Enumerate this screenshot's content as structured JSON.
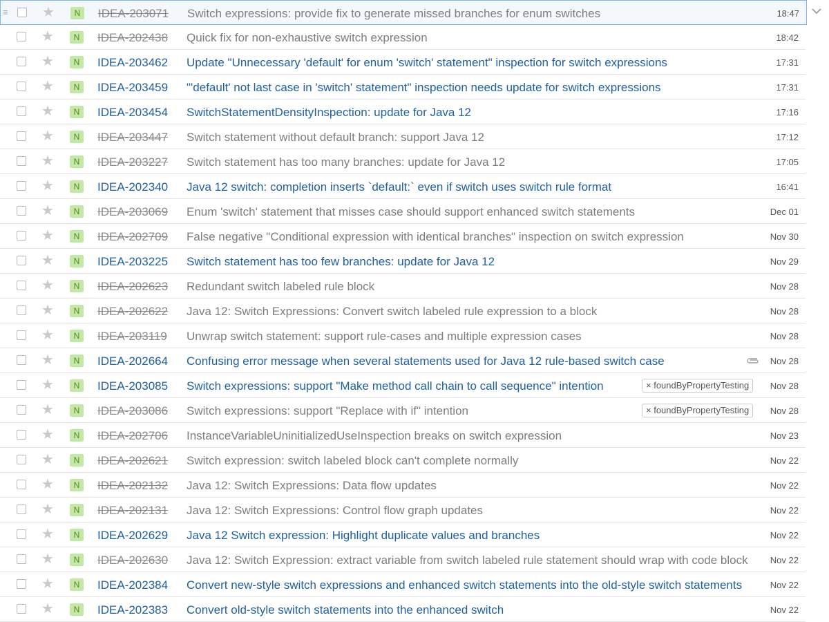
{
  "issues": [
    {
      "id": "IDEA-203071",
      "summary": "Switch expressions: provide fix to generate missed branches for enum switches",
      "date": "18:47",
      "resolved": true,
      "badge": "N"
    },
    {
      "id": "IDEA-202438",
      "summary": "Quick fix for non-exhaustive switch expression",
      "date": "18:42",
      "resolved": true,
      "badge": "N"
    },
    {
      "id": "IDEA-203462",
      "summary": "Update \"Unnecessary 'default' for enum 'switch' statement\" inspection for switch expressions",
      "date": "17:31",
      "resolved": false,
      "badge": "N"
    },
    {
      "id": "IDEA-203459",
      "summary": "\"'default' not last case in 'switch' statement\" inspection needs update for switch expressions",
      "date": "17:31",
      "resolved": false,
      "badge": "N"
    },
    {
      "id": "IDEA-203454",
      "summary": "SwitchStatementDensityInspection: update for Java 12",
      "date": "17:16",
      "resolved": false,
      "badge": "N"
    },
    {
      "id": "IDEA-203447",
      "summary": "Switch statement without default branch: support Java 12",
      "date": "17:12",
      "resolved": true,
      "badge": "N"
    },
    {
      "id": "IDEA-203227",
      "summary": "Switch statement has too many branches: update for Java 12",
      "date": "17:05",
      "resolved": true,
      "badge": "N"
    },
    {
      "id": "IDEA-202340",
      "summary": "Java 12 switch: completion inserts `default:` even if switch uses switch rule format",
      "date": "16:41",
      "resolved": false,
      "badge": "N"
    },
    {
      "id": "IDEA-203069",
      "summary": "Enum 'switch' statement that misses case should support enhanced switch statements",
      "date": "Dec 01",
      "resolved": true,
      "badge": "N"
    },
    {
      "id": "IDEA-202709",
      "summary": "False negative \"Conditional expression with identical branches\" inspection on switch expression",
      "date": "Nov 30",
      "resolved": true,
      "badge": "N"
    },
    {
      "id": "IDEA-203225",
      "summary": "Switch statement has too few branches: update for Java 12",
      "date": "Nov 29",
      "resolved": false,
      "badge": "N"
    },
    {
      "id": "IDEA-202623",
      "summary": "Redundant switch labeled rule block",
      "date": "Nov 28",
      "resolved": true,
      "badge": "N"
    },
    {
      "id": "IDEA-202622",
      "summary": "Java 12: Switch Expressions: Convert switch labeled rule expression to a block",
      "date": "Nov 28",
      "resolved": true,
      "badge": "N"
    },
    {
      "id": "IDEA-203119",
      "summary": "Unwrap switch statement: support rule-cases and multiple expression cases",
      "date": "Nov 28",
      "resolved": true,
      "badge": "N"
    },
    {
      "id": "IDEA-202664",
      "summary": "Confusing error message when several statements used for Java 12 rule-based switch case",
      "date": "Nov 28",
      "resolved": false,
      "badge": "N",
      "attachment": true
    },
    {
      "id": "IDEA-203085",
      "summary": "Switch expressions: support \"Make method call chain to call sequence\" intention",
      "date": "Nov 28",
      "resolved": false,
      "badge": "N",
      "tag": "× foundByPropertyTesting"
    },
    {
      "id": "IDEA-203086",
      "summary": "Switch expressions: support \"Replace with if\" intention",
      "date": "Nov 28",
      "resolved": true,
      "badge": "N",
      "tag": "× foundByPropertyTesting"
    },
    {
      "id": "IDEA-202706",
      "summary": "InstanceVariableUninitializedUseInspection breaks on switch expression",
      "date": "Nov 23",
      "resolved": true,
      "badge": "N"
    },
    {
      "id": "IDEA-202621",
      "summary": "Switch expression: switch labeled block can't complete normally",
      "date": "Nov 22",
      "resolved": true,
      "badge": "N"
    },
    {
      "id": "IDEA-202132",
      "summary": "Java 12: Switch Expressions: Data flow updates",
      "date": "Nov 22",
      "resolved": true,
      "badge": "N"
    },
    {
      "id": "IDEA-202131",
      "summary": "Java 12: Switch Expressions: Control flow graph updates",
      "date": "Nov 22",
      "resolved": true,
      "badge": "N"
    },
    {
      "id": "IDEA-202629",
      "summary": "Java 12 Switch expression: Highlight duplicate values and branches",
      "date": "Nov 22",
      "resolved": false,
      "badge": "N"
    },
    {
      "id": "IDEA-202630",
      "summary": "Java 12: Switch Expression: extract variable from switch labeled rule statement should wrap with code block",
      "date": "Nov 22",
      "resolved": true,
      "badge": "N"
    },
    {
      "id": "IDEA-202384",
      "summary": "Convert new-style switch expressions and enhanced switch statements into the old-style switch statements",
      "date": "Nov 22",
      "resolved": false,
      "badge": "N"
    },
    {
      "id": "IDEA-202383",
      "summary": "Convert old-style switch statements into the enhanced switch",
      "date": "Nov 22",
      "resolved": false,
      "badge": "N"
    }
  ],
  "icons": {
    "star": "star-icon",
    "drag": "drag-handle-icon",
    "attachment": "paperclip-icon",
    "expand": "chevron-down-icon"
  },
  "colors": {
    "link": "#1f5fa3",
    "resolved": "#7d7d7d",
    "badge_bg": "#c6e8a7",
    "badge_fg": "#4b8a23",
    "focus_border": "#7fb6e6"
  }
}
